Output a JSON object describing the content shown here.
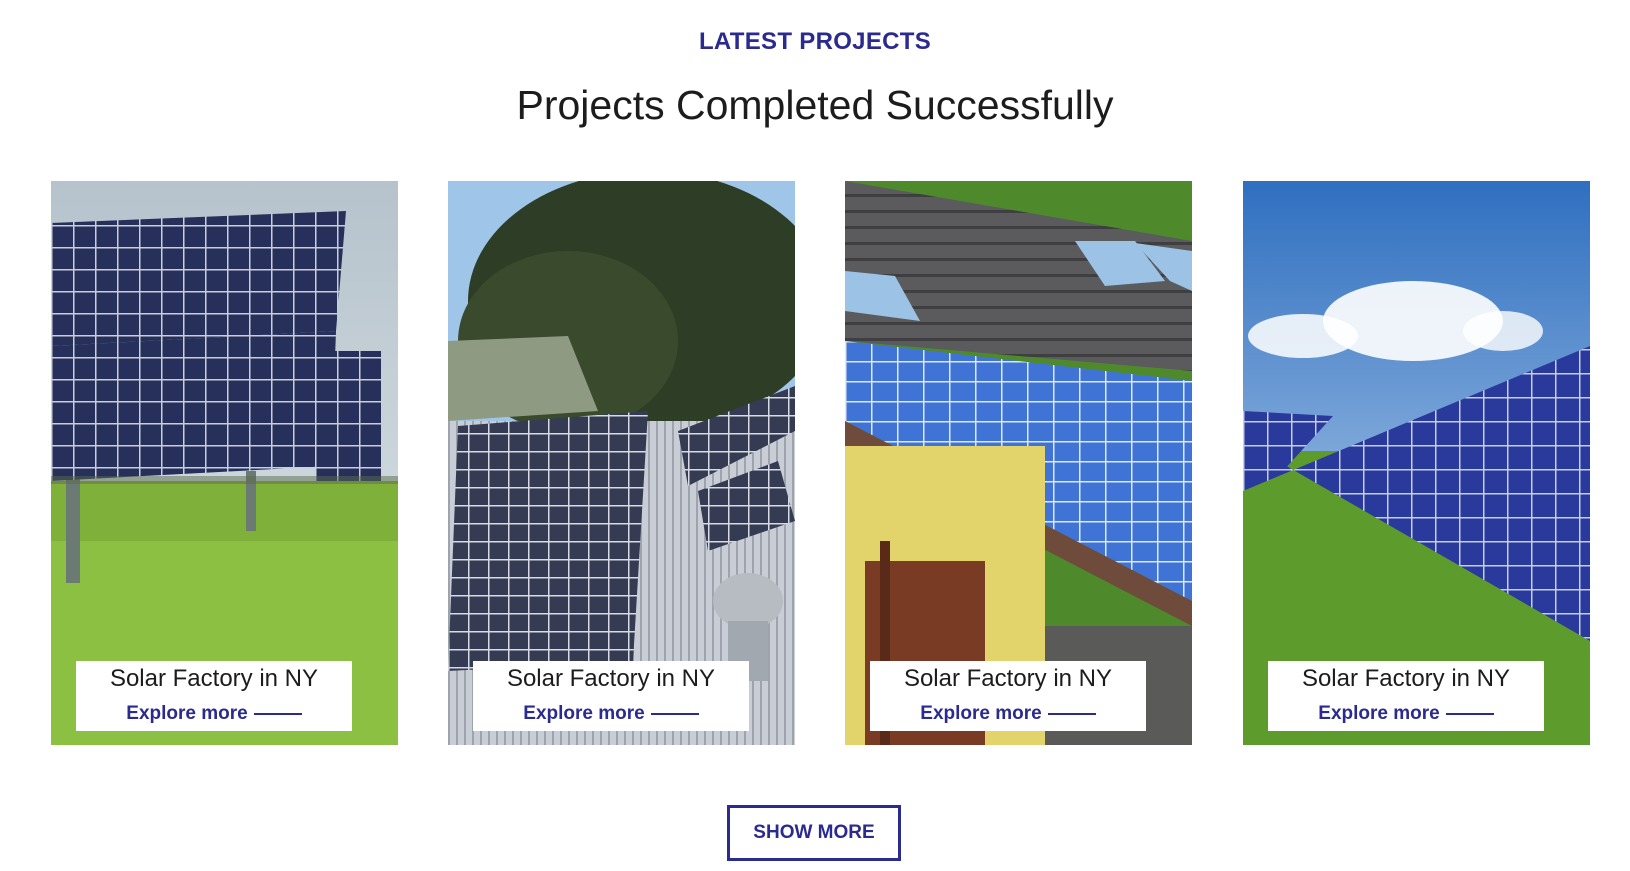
{
  "section": {
    "eyebrow": "LATEST PROJECTS",
    "title": "Projects Completed Successfully"
  },
  "projects": [
    {
      "title": "Solar Factory in NY",
      "link": "Explore more"
    },
    {
      "title": "Solar Factory in NY",
      "link": "Explore more"
    },
    {
      "title": "Solar Factory in NY",
      "link": "Explore more"
    },
    {
      "title": "Solar Factory in NY",
      "link": "Explore more"
    }
  ],
  "show_more_label": "SHOW MORE",
  "colors": {
    "accent": "#2b2a8f",
    "heading": "#1c1c1c",
    "panel": "#1d2a6e",
    "panel_light": "#3a6fd8"
  }
}
